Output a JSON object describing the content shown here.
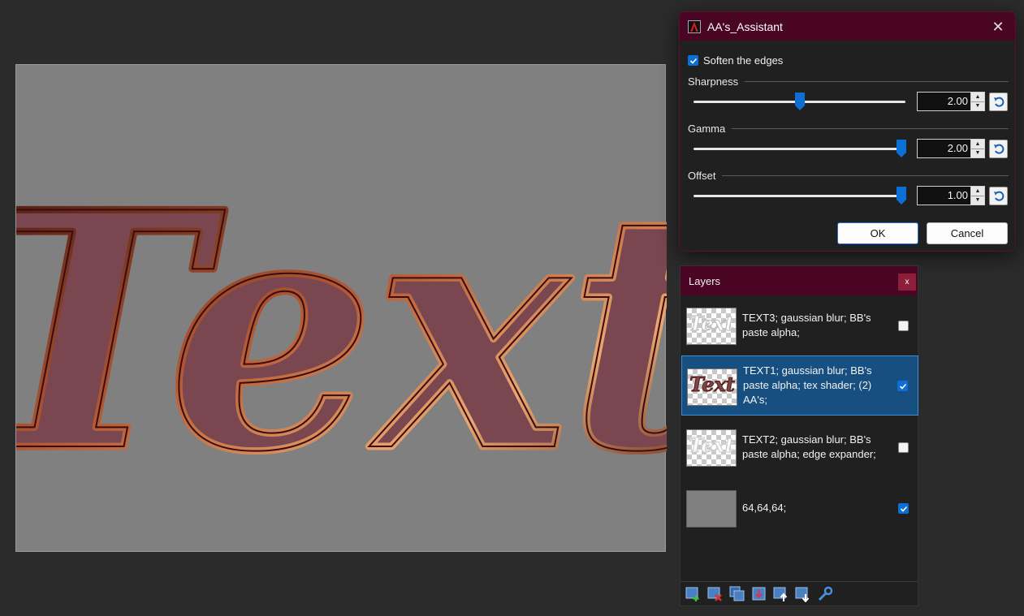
{
  "canvas": {
    "text": "Text",
    "background": "#808080"
  },
  "dialog": {
    "title": "AA's_Assistant",
    "close_glyph": "✕",
    "soften_edges": {
      "label": "Soften the edges",
      "checked": true
    },
    "groups": [
      {
        "label": "Sharpness",
        "value": "2.00",
        "slider_fraction": 0.5
      },
      {
        "label": "Gamma",
        "value": "2.00",
        "slider_fraction": 0.98
      },
      {
        "label": "Offset",
        "value": "1.00",
        "slider_fraction": 0.98
      }
    ],
    "ok_label": "OK",
    "cancel_label": "Cancel"
  },
  "layers_panel": {
    "title": "Layers",
    "close_glyph": "x",
    "layers": [
      {
        "name": "TEXT3; gaussian blur; BB's paste alpha;",
        "visible": false,
        "selected": false,
        "thumbnail": "Text"
      },
      {
        "name": "TEXT1; gaussian blur; BB's paste alpha; tex shader; (2) AA's;",
        "visible": true,
        "selected": true,
        "thumbnail": "Text"
      },
      {
        "name": "TEXT2; gaussian blur; BB's paste alpha; edge expander;",
        "visible": false,
        "selected": false,
        "thumbnail": "Text"
      },
      {
        "name": "64,64,64;",
        "visible": true,
        "selected": false,
        "thumbnail": ""
      }
    ],
    "toolbar_icons": [
      "add-layer-icon",
      "delete-layer-icon",
      "duplicate-layer-icon",
      "merge-down-icon",
      "move-layer-up-icon",
      "move-layer-down-icon",
      "layer-properties-icon"
    ]
  },
  "colors": {
    "accent": "#0b6fd6",
    "titlebar": "#4a0524",
    "selection": "#174f80",
    "text_fill": "#7a4650",
    "text_edge": "#5a1a12"
  }
}
